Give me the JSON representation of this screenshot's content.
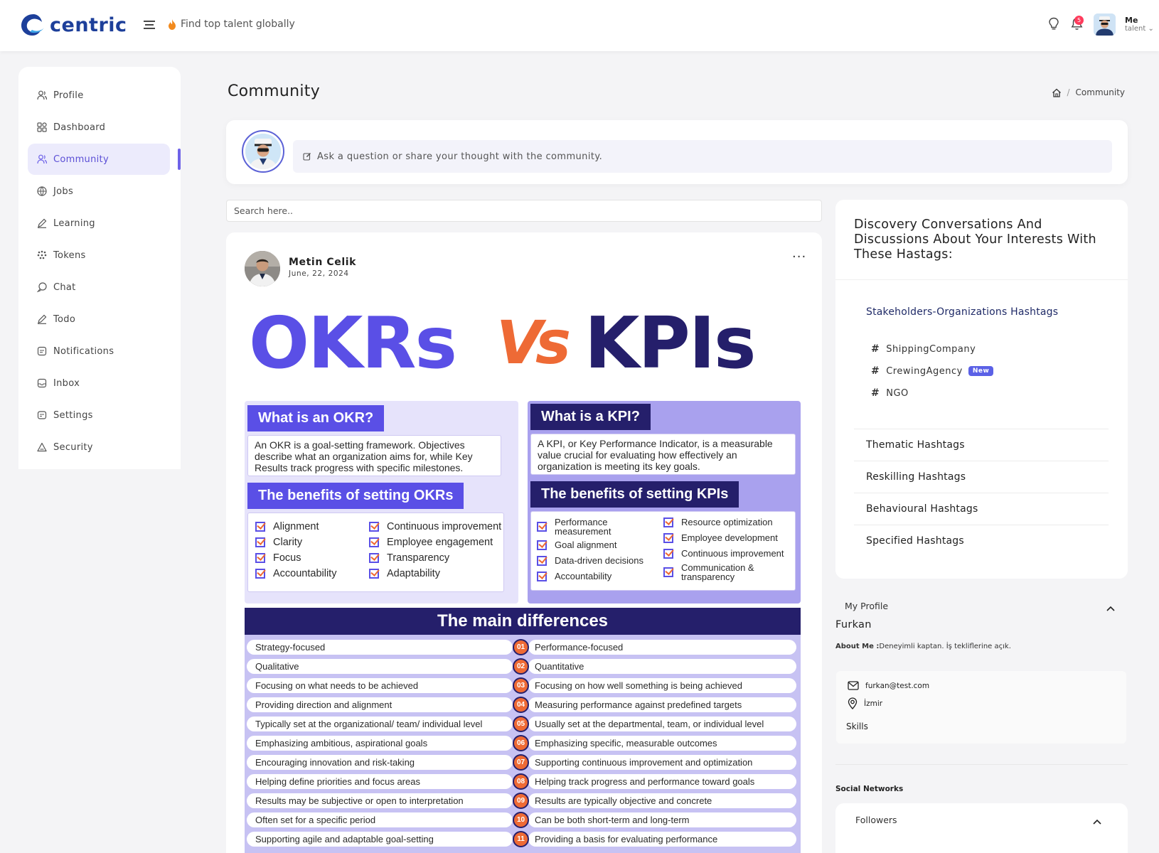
{
  "app": {
    "brand": "centric",
    "tagline": "Find top talent globally",
    "notification_count": "5",
    "user_name": "Me",
    "user_role": "talent"
  },
  "sidebar": {
    "items": [
      {
        "label": "Profile",
        "icon": "user-icon"
      },
      {
        "label": "Dashboard",
        "icon": "dashboard-icon"
      },
      {
        "label": "Community",
        "icon": "users-icon",
        "active": true
      },
      {
        "label": "Jobs",
        "icon": "globe-icon"
      },
      {
        "label": "Learning",
        "icon": "pencil-icon"
      },
      {
        "label": "Tokens",
        "icon": "tokens-icon"
      },
      {
        "label": "Chat",
        "icon": "chat-icon"
      },
      {
        "label": "Todo",
        "icon": "pencil-icon"
      },
      {
        "label": "Notifications",
        "icon": "notification-icon"
      },
      {
        "label": "Inbox",
        "icon": "inbox-icon"
      },
      {
        "label": "Settings",
        "icon": "settings-icon"
      },
      {
        "label": "Security",
        "icon": "security-icon"
      }
    ]
  },
  "page": {
    "title": "Community",
    "breadcrumb": "Community"
  },
  "composer": {
    "placeholder": "Ask a question or share your thought with the community."
  },
  "search": {
    "placeholder": "Search here.."
  },
  "post": {
    "author": "Metin Celik",
    "date": "June, 22, 2024",
    "more": "···",
    "infographic": {
      "title_left": "OKRs",
      "title_vs": "Vs",
      "title_right": "KPIs",
      "okr_heading": "What is an OKR?",
      "okr_text": "An OKR is a goal-setting framework. Objectives describe what an organization aims for, while Key Results track progress with specific milestones.",
      "okr_benefits_heading": "The benefits of setting OKRs",
      "okr_benefits_col1": [
        "Alignment",
        "Clarity",
        "Focus",
        "Accountability"
      ],
      "okr_benefits_col2": [
        "Continuous improvement",
        "Employee engagement",
        "Transparency",
        "Adaptability"
      ],
      "kpi_heading": "What is a KPI?",
      "kpi_text": "A KPI, or Key Performance Indicator, is a measurable value crucial for evaluating how effectively an organization is meeting its key goals.",
      "kpi_benefits_heading": "The benefits of setting KPIs",
      "kpi_benefits_col1": [
        "Performance measurement",
        "Goal alignment",
        "Data-driven decisions",
        "Accountability"
      ],
      "kpi_benefits_col2": [
        "Resource optimization",
        "Employee development",
        "Continuous improvement",
        "Communication & transparency"
      ],
      "differences_heading": "The main differences",
      "differences": [
        {
          "n": "01",
          "okr": "Strategy-focused",
          "kpi": "Performance-focused"
        },
        {
          "n": "02",
          "okr": "Qualitative",
          "kpi": "Quantitative"
        },
        {
          "n": "03",
          "okr": "Focusing on what needs to be achieved",
          "kpi": "Focusing on how well something is being achieved"
        },
        {
          "n": "04",
          "okr": "Providing direction and alignment",
          "kpi": "Measuring performance against predefined targets"
        },
        {
          "n": "05",
          "okr": "Typically set at the organizational/ team/ individual level",
          "kpi": "Usually set at the departmental, team, or individual level"
        },
        {
          "n": "06",
          "okr": "Emphasizing ambitious, aspirational goals",
          "kpi": "Emphasizing specific, measurable outcomes"
        },
        {
          "n": "07",
          "okr": "Encouraging innovation and risk-taking",
          "kpi": "Supporting continuous improvement and optimization"
        },
        {
          "n": "08",
          "okr": "Helping define priorities and focus areas",
          "kpi": "Helping track progress and performance toward goals"
        },
        {
          "n": "09",
          "okr": "Results may be subjective or open to interpretation",
          "kpi": "Results are typically objective and concrete"
        },
        {
          "n": "10",
          "okr": "Often set for a specific period",
          "kpi": "Can be both short-term and long-term"
        },
        {
          "n": "11",
          "okr": "Supporting agile and adaptable goal-setting",
          "kpi": "Providing a basis for evaluating performance"
        }
      ]
    }
  },
  "hashtags": {
    "title": "Discovery Conversations And Discussions About Your Interests With These Hastags:",
    "open_group": "Stakeholders-Organizations Hashtags",
    "tags": [
      {
        "label": "ShippingCompany",
        "badge": ""
      },
      {
        "label": "CrewingAgency",
        "badge": "New"
      },
      {
        "label": "NGO",
        "badge": ""
      }
    ],
    "groups": [
      "Thematic Hashtags",
      "Reskilling Hashtags",
      "Behavioural Hashtags",
      "Specified Hashtags"
    ]
  },
  "profile": {
    "label": "My Profile",
    "name": "Furkan",
    "about_label": "About Me :",
    "about_text": "Deneyimli kaptan. İş tekliflerine açık.",
    "email": "furkan@test.com",
    "location": "İzmir",
    "skills_label": "Skills"
  },
  "social": {
    "label": "Social Networks",
    "followers_label": "Followers"
  },
  "colors": {
    "brand": "#1d3f9a",
    "accent": "#5b4fd6",
    "okr_purple": "#5a4fe6",
    "kpi_navy": "#251f6b",
    "vs_orange": "#ee6a35"
  }
}
